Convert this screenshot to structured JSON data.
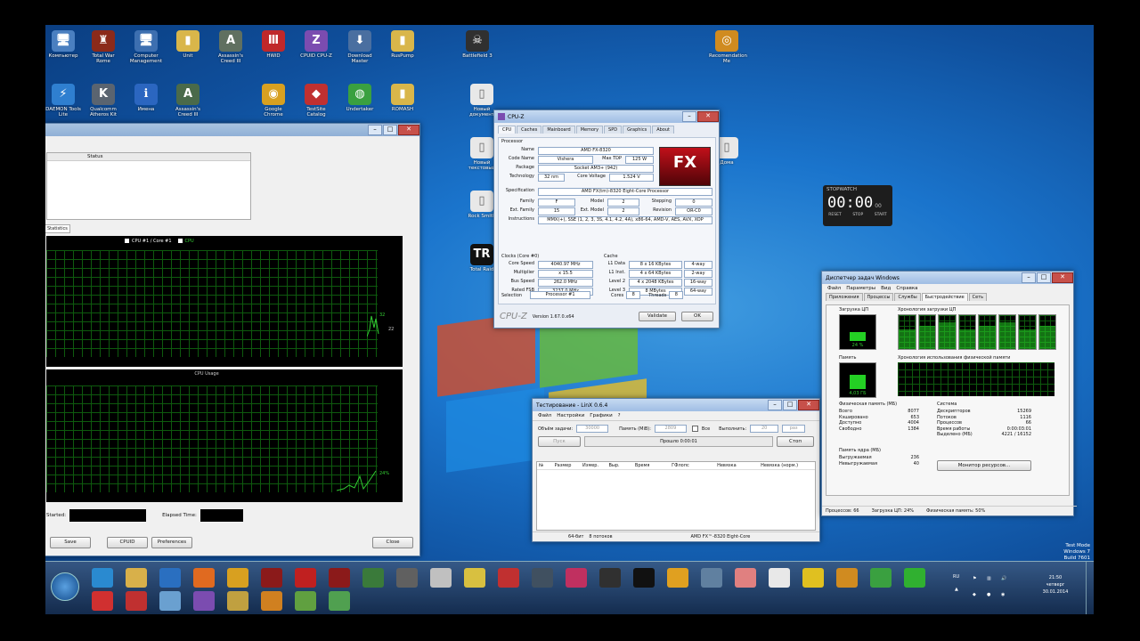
{
  "desktop_icons": [
    {
      "label": "Компьютер",
      "glyph": "🖥",
      "color": "#4a7fc0"
    },
    {
      "label": "Total War Rome",
      "glyph": "♜",
      "color": "#8b2a1a"
    },
    {
      "label": "Computer Management",
      "glyph": "🖥",
      "color": "#3d6fb0"
    },
    {
      "label": "Unit",
      "glyph": "▮",
      "color": "#d9b64a"
    },
    {
      "label": "Assassin's Creed III",
      "glyph": "A",
      "color": "#607060"
    },
    {
      "label": "HWiD",
      "glyph": "Ⅲ",
      "color": "#c0282a"
    },
    {
      "label": "CPUID CPU-Z",
      "glyph": "Z",
      "color": "#7b4cb0"
    },
    {
      "label": "Download Master",
      "glyph": "⬇",
      "color": "#4a6fa0"
    },
    {
      "label": "RusPump",
      "glyph": "▮",
      "color": "#d9b64a"
    },
    {
      "label": "Battlefield 3",
      "glyph": "☠",
      "color": "#303030"
    },
    {
      "label": "Recomendation Me",
      "glyph": "◎",
      "color": "#d08b20"
    },
    {
      "label": "DAEMON Tools Lite",
      "glyph": "⚡",
      "color": "#2f7fd0"
    },
    {
      "label": "Qualcomm Atheros Kit",
      "glyph": "K",
      "color": "#5a6470"
    },
    {
      "label": "Имена",
      "glyph": "ℹ",
      "color": "#2b66c0"
    },
    {
      "label": "Assassin's Creed III",
      "glyph": "A",
      "color": "#4a6a4a"
    },
    {
      "label": "Google Chrome",
      "glyph": "◉",
      "color": "#d8a020"
    },
    {
      "label": "TestSite Catalog",
      "glyph": "◆",
      "color": "#c03030"
    },
    {
      "label": "Undertaker",
      "glyph": "◍",
      "color": "#3aa040"
    },
    {
      "label": "ROMASH",
      "glyph": "▮",
      "color": "#d9b64a"
    },
    {
      "label": "Новый документ",
      "glyph": "▯",
      "color": "#e8e8e8"
    },
    {
      "label": "Новый текстовый",
      "glyph": "▯",
      "color": "#e8e8e8"
    },
    {
      "label": "Rock Smith",
      "glyph": "▯",
      "color": "#e8e8e8"
    },
    {
      "label": "Total Raid",
      "glyph": "TR",
      "color": "#111"
    },
    {
      "label": "Дома",
      "glyph": "▯",
      "color": "#e8e8e8"
    }
  ],
  "stopwatch": {
    "brand": "STOPWATCH",
    "time": "00:00",
    "sub": "00",
    "buttons": [
      "RESET",
      "STOP",
      "START"
    ]
  },
  "cpuid_window": {
    "legend_label": "CPU #1 / Core #1",
    "legend_extra": "CPU",
    "usage_title": "CPU Usage",
    "table_header": "Status",
    "tab_label": "Statistics",
    "started_label": "Started:",
    "elapsed_label": "Elapsed Time:",
    "buttons": [
      "Save",
      "CPUID",
      "Preferences",
      "Close"
    ],
    "graph_value_1": "32",
    "graph_value_2": "22",
    "usage_value": "24%"
  },
  "cpuz": {
    "title": "CPU-Z",
    "tabs": [
      "CPU",
      "Caches",
      "Mainboard",
      "Memory",
      "SPD",
      "Graphics",
      "About"
    ],
    "processor_section": "Processor",
    "name": "AMD FX-8320",
    "code_name": "Vishera",
    "max_tdp": "125 W",
    "package": "Socket AM3+ (942)",
    "technology": "32 nm",
    "core_voltage": "1.524 V",
    "specification": "AMD FX(tm)-8320 Eight-Core Processor",
    "family": "F",
    "model": "2",
    "stepping": "0",
    "ext_family": "15",
    "ext_model": "2",
    "revision": "OR-C0",
    "instructions": "MMX(+), SSE (1, 2, 3, 3S, 4.1, 4.2, 4A), x86-64, AMD-V, AES, AVX, XOP",
    "clocks_section": "Clocks (Core #0)",
    "cache_section": "Cache",
    "core_speed": "4040.97 MHz",
    "multiplier": "x 15.5",
    "bus_speed": "262.0 MHz",
    "rated_fsb": "3237.0 MHz",
    "l1_data": "8 x 16 KBytes",
    "l1_data_way": "4-way",
    "l1_inst": "4 x 64 KBytes",
    "l1_inst_way": "2-way",
    "level2": "4 x 2048 KBytes",
    "level2_way": "16-way",
    "level3": "8 MBytes",
    "level3_way": "64-way",
    "selection_label": "Selection",
    "selection_value": "Processor #1",
    "cores_label": "Cores",
    "cores": "8",
    "threads_label": "Threads",
    "threads": "8",
    "brand": "CPU-Z",
    "version": "Version 1.67.0.x64",
    "validate": "Validate",
    "ok": "OK",
    "labels": {
      "name": "Name",
      "code": "Code Name",
      "tdp": "Max TDP",
      "pkg": "Package",
      "tech": "Technology",
      "volt": "Core Voltage",
      "spec": "Specification",
      "fam": "Family",
      "mod": "Model",
      "step": "Stepping",
      "efam": "Ext. Family",
      "emod": "Ext. Model",
      "rev": "Revision",
      "instr": "Instructions",
      "cs": "Core Speed",
      "mul": "Multiplier",
      "bus": "Bus Speed",
      "fsb": "Rated FSB",
      "l1d": "L1 Data",
      "l1i": "L1 Inst.",
      "l2": "Level 2",
      "l3": "Level 3"
    }
  },
  "linx": {
    "title": "Тестирование - LinX 0.6.4",
    "menu": [
      "Файл",
      "Настройки",
      "Графики",
      "?"
    ],
    "size_label": "Объём задачи:",
    "size_value": "30000",
    "mem_label": "Память (MiB):",
    "mem_value": "2809",
    "all_label": "Все",
    "run_label": "Выполнить:",
    "run_value": "20",
    "run_unit": "раз",
    "start": "Пуск",
    "progress": "Прошло 0:00:01",
    "stop": "Стоп",
    "columns": [
      "№",
      "Размер",
      "Измер.",
      "Выр.",
      "Время",
      "ГФлопс",
      "Невязка",
      "Невязка (норм.)"
    ],
    "status_left": "64-бит",
    "status_threads": "8 потоков",
    "status_cpu": "AMD FX™-8320 Eight-Core"
  },
  "taskmgr": {
    "title": "Диспетчер задач Windows",
    "menu": [
      "Файл",
      "Параметры",
      "Вид",
      "Справка"
    ],
    "tabs": [
      "Приложения",
      "Процессы",
      "Службы",
      "Быстродействие",
      "Сеть"
    ],
    "cpu_usage_label": "Загрузка ЦП",
    "cpu_value": "24 %",
    "cpu_history_label": "Хронология загрузки ЦП",
    "mem_label": "Память",
    "mem_value": "4,03 ГБ",
    "mem_history_label": "Хронология использования физической памяти",
    "phys_label": "Физическая память (МБ)",
    "phys_rows": [
      [
        "Всего",
        "8077"
      ],
      [
        "Кэшировано",
        "653"
      ],
      [
        "Доступно",
        "4004"
      ],
      [
        "Свободно",
        "1384"
      ]
    ],
    "sys_label": "Система",
    "sys_rows": [
      [
        "Дескрипторов",
        "15269"
      ],
      [
        "Потоков",
        "1116"
      ],
      [
        "Процессов",
        "66"
      ],
      [
        "Время работы",
        "0:00:03:01"
      ],
      [
        "Выделено (МБ)",
        "4221 / 16152"
      ]
    ],
    "kernel_label": "Память ядра (МБ)",
    "kernel_rows": [
      [
        "Выгружаемая",
        "236"
      ],
      [
        "Невыгружаемая",
        "40"
      ]
    ],
    "monitor_button": "Монитор ресурсов...",
    "status": [
      "Процессов: 66",
      "Загрузка ЦП: 24%",
      "Физическая память: 50%"
    ]
  },
  "watermark": [
    "Test Mode",
    "Windows 7",
    "Build 7601"
  ],
  "tray": {
    "lang": "RU",
    "time": "21:50",
    "day": "четверг",
    "date": "30.01.2014"
  }
}
